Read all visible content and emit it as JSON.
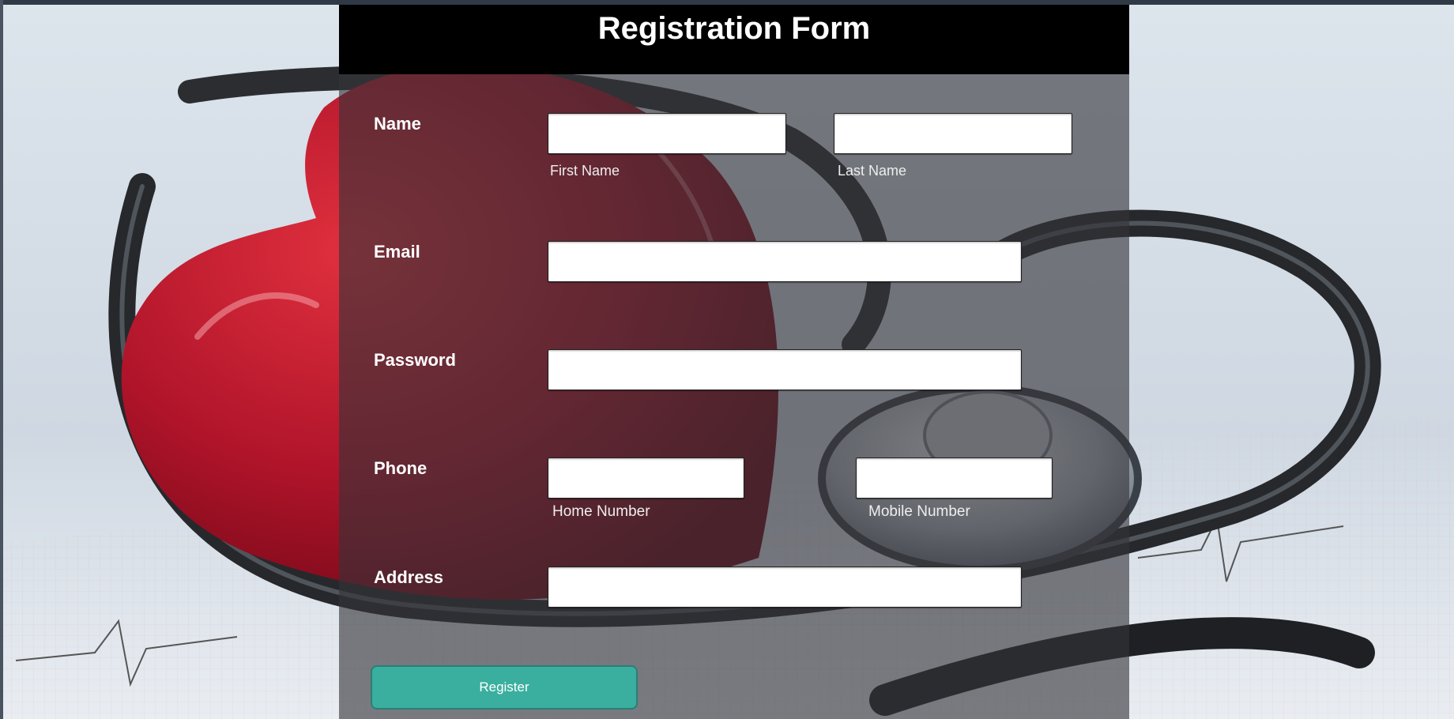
{
  "form": {
    "title": "Registration Form",
    "name": {
      "label": "Name",
      "first_name_caption": "First Name",
      "last_name_caption": "Last Name",
      "first_name_value": "",
      "last_name_value": ""
    },
    "email": {
      "label": "Email",
      "value": ""
    },
    "password": {
      "label": "Password",
      "value": ""
    },
    "phone": {
      "label": "Phone",
      "home_caption": "Home Number",
      "mobile_caption": "Mobile Number",
      "home_value": "",
      "mobile_value": ""
    },
    "address": {
      "label": "Address",
      "value": ""
    },
    "register_label": "Register"
  },
  "colors": {
    "header_background": "#000000",
    "panel_overlay": "#343438",
    "register_button": "#3aaf9f",
    "heart": "#a8102a"
  },
  "background": {
    "subject": "stethoscope-and-red-heart-on-ecg-paper"
  }
}
